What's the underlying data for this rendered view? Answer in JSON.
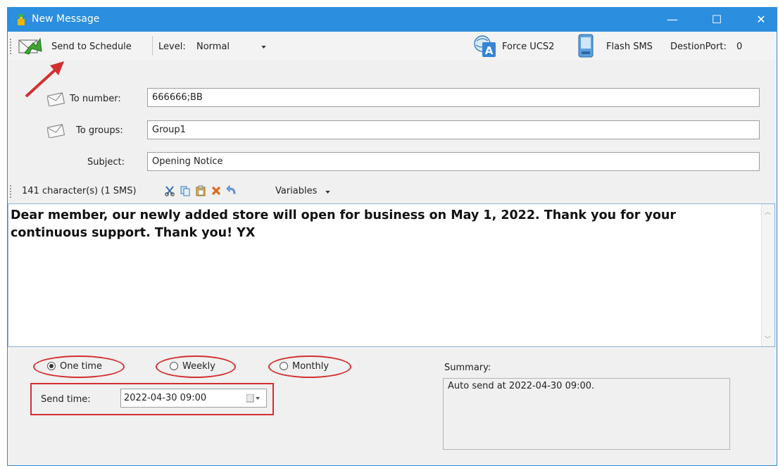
{
  "window": {
    "title": "New Message",
    "minimize_glyph": "—",
    "maximize_glyph": "☐",
    "close_glyph": "✕"
  },
  "toolbar": {
    "send_to_schedule_label": "Send to Schedule",
    "level_label": "Level:",
    "level_value": "Normal",
    "force_ucs2_label": "Force UCS2",
    "flash_sms_label": "Flash SMS",
    "destport_label": "DestionPort:",
    "destport_value": "0"
  },
  "form": {
    "to_number_label": "To number:",
    "to_number_value": "666666;BB",
    "to_groups_label": "To groups:",
    "to_groups_value": "Group1",
    "subject_label": "Subject:",
    "subject_value": "Opening Notice"
  },
  "infobar": {
    "char_count": "141 character(s) (1 SMS)",
    "variables_label": "Variables"
  },
  "message": {
    "body": "Dear member, our newly added store will open for business on May 1, 2022. Thank you for your continuous support. Thank you! YX"
  },
  "schedule": {
    "options": [
      {
        "label": "One time",
        "checked": true
      },
      {
        "label": "Weekly",
        "checked": false
      },
      {
        "label": "Monthly",
        "checked": false
      }
    ],
    "send_time_label": "Send time:",
    "send_time_value": "2022-04-30 09:00",
    "summary_label": "Summary:",
    "summary_text": "Auto send at 2022-04-30 09:00."
  },
  "colors": {
    "title_bar": "#2b8ede",
    "annotation_red": "#d32f2f",
    "dialog_bg": "#f0f0f0"
  },
  "icons": [
    "app-icon",
    "send-schedule-icon",
    "dropdown-arrow-icon",
    "force-ucs2-icon",
    "flash-sms-icon",
    "envelope-icon",
    "cut-icon",
    "copy-icon",
    "paste-icon",
    "delete-icon",
    "undo-icon",
    "calendar-icon",
    "annotation-arrow"
  ]
}
